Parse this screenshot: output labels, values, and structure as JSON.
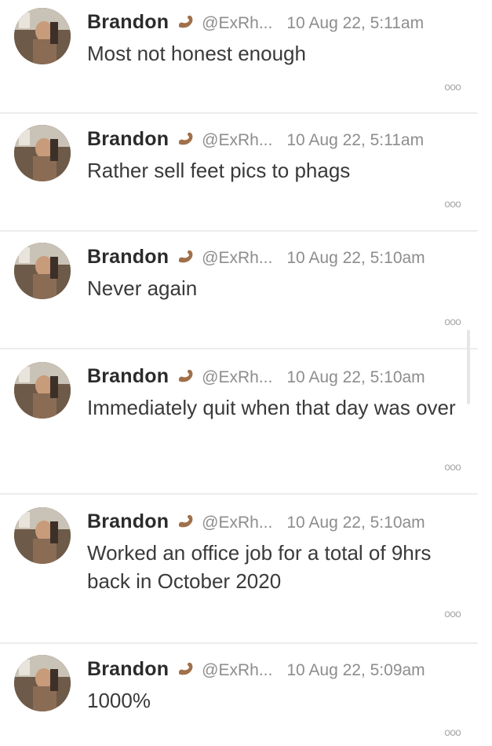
{
  "accent_colors": {
    "text": "#3a3a3a",
    "meta": "#8d8d8d",
    "divider": "#ececec"
  },
  "tweets": [
    {
      "name": "Brandon",
      "badge_icon": "flexed-arm-icon",
      "handle": "@ExRh...",
      "time": "10 Aug 22, 5:11am",
      "text": "Most not honest enough",
      "more_label": "ooo"
    },
    {
      "name": "Brandon",
      "badge_icon": "flexed-arm-icon",
      "handle": "@ExRh...",
      "time": "10 Aug 22, 5:11am",
      "text": "Rather sell feet pics to phags",
      "more_label": "ooo"
    },
    {
      "name": "Brandon",
      "badge_icon": "flexed-arm-icon",
      "handle": "@ExRh...",
      "time": "10 Aug 22, 5:10am",
      "text": "Never again",
      "more_label": "ooo"
    },
    {
      "name": "Brandon",
      "badge_icon": "flexed-arm-icon",
      "handle": "@ExRh...",
      "time": "10 Aug 22, 5:10am",
      "text": "Immediately quit when that day was over",
      "more_label": "ooo"
    },
    {
      "name": "Brandon",
      "badge_icon": "flexed-arm-icon",
      "handle": "@ExRh...",
      "time": "10 Aug 22, 5:10am",
      "text": "Worked an office job for a total of 9hrs back in October 2020",
      "more_label": "ooo"
    },
    {
      "name": "Brandon",
      "badge_icon": "flexed-arm-icon",
      "handle": "@ExRh...",
      "time": "10 Aug 22, 5:09am",
      "text": "1000%",
      "more_label": "ooo"
    }
  ]
}
